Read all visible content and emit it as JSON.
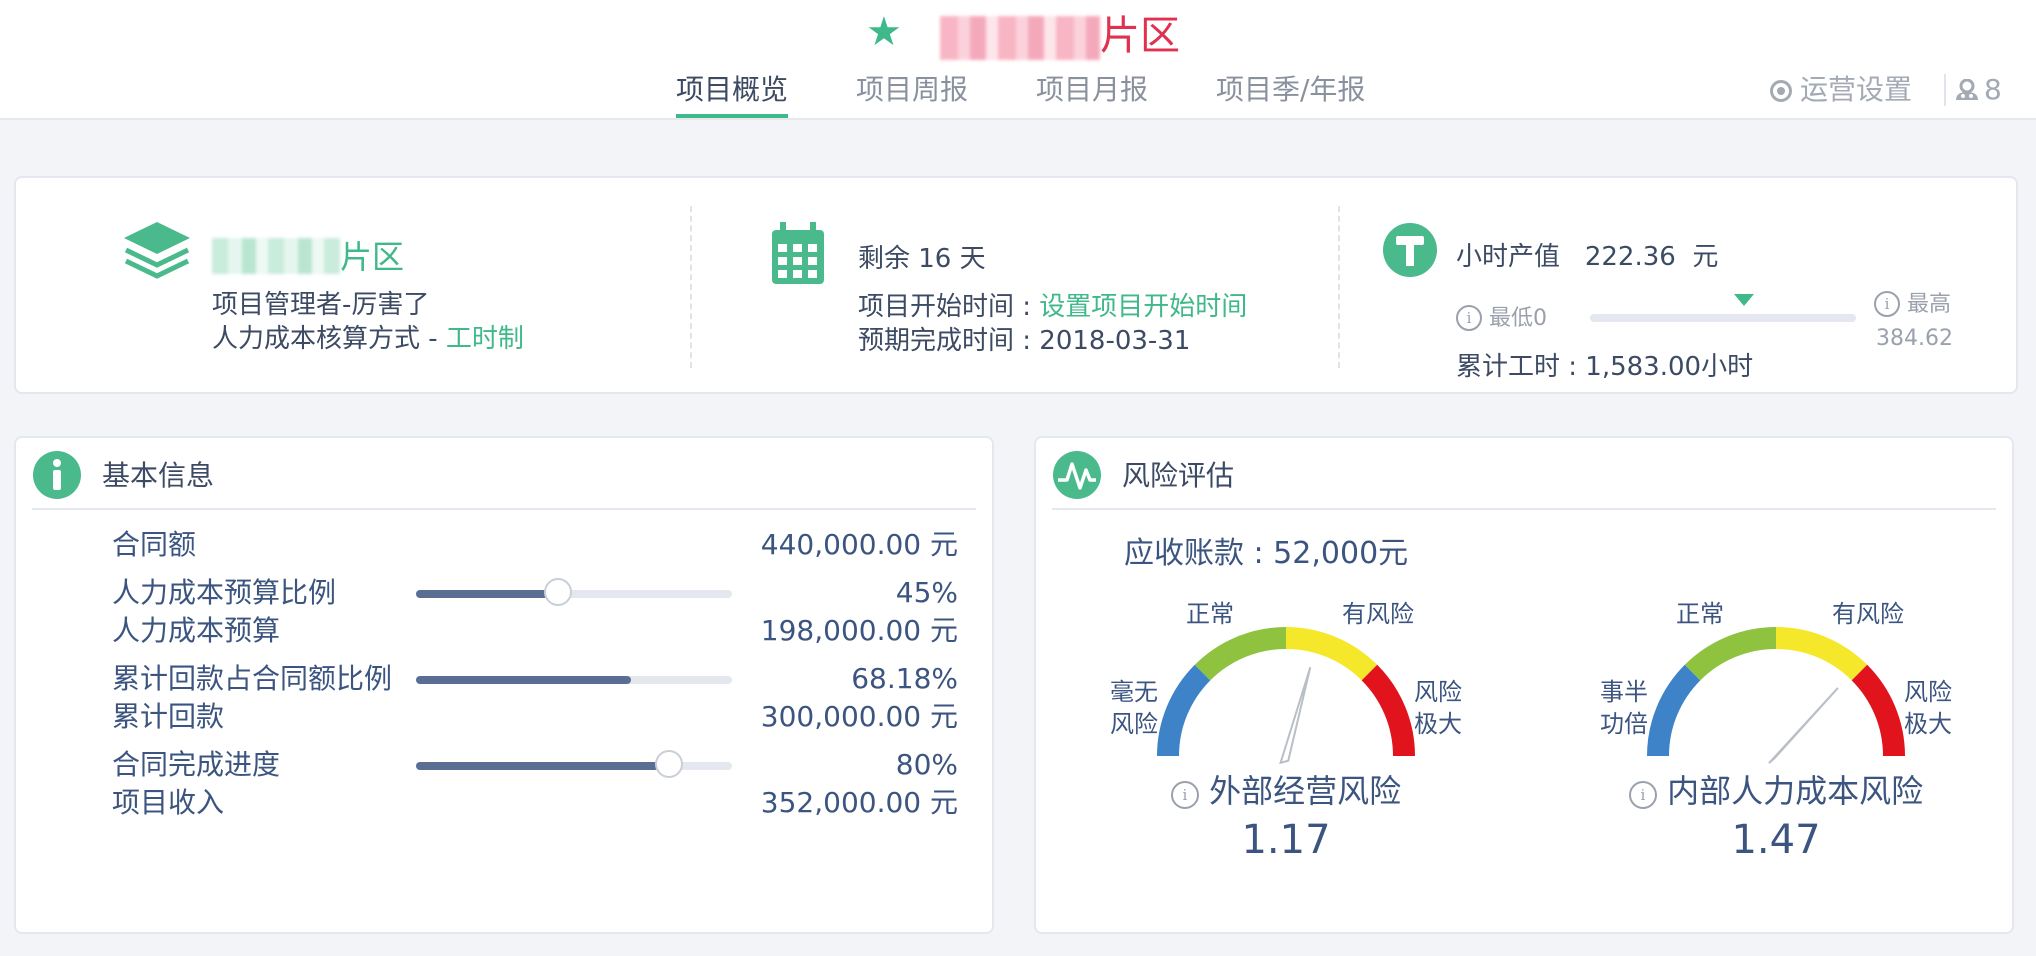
{
  "header": {
    "title_suffix": "片区",
    "tabs": [
      {
        "label": "项目概览"
      },
      {
        "label": "项目周报"
      },
      {
        "label": "项目月报"
      },
      {
        "label": "项目季/年报"
      }
    ],
    "ops_settings": "运营设置",
    "user_count": "8"
  },
  "summary": {
    "area": {
      "name_suffix": "片区",
      "manager": "项目管理者-厉害了",
      "cost_method_label": "人力成本核算方式 - ",
      "cost_method_value": "工时制"
    },
    "schedule": {
      "remaining": "剩余 16 天",
      "start_label": "项目开始时间 : ",
      "start_link": "设置项目开始时间",
      "end_text": "预期完成时间 : 2018-03-31"
    },
    "hourly": {
      "title": "小时产值",
      "value": "222.36",
      "unit": "元",
      "min_label": "最低0",
      "max_label": "最高",
      "max_value": "384.62",
      "marker_fraction": 0.578,
      "total_hours": "累计工时 : 1,583.00小时"
    }
  },
  "basic_info": {
    "title": "基本信息",
    "rows": [
      {
        "label": "合同额",
        "value": "440,000.00 元"
      },
      {
        "label": "人力成本预算比例",
        "value": "45%",
        "fraction": 0.45
      },
      {
        "label": "人力成本预算",
        "value": "198,000.00 元"
      },
      {
        "label": "累计回款占合同额比例",
        "value": "68.18%",
        "fraction": 0.6818
      },
      {
        "label": "累计回款",
        "value": "300,000.00 元"
      },
      {
        "label": "合同完成进度",
        "value": "80%",
        "fraction": 0.8
      },
      {
        "label": "项目收入",
        "value": "352,000.00 元"
      }
    ]
  },
  "risk": {
    "title": "风险评估",
    "receivable": "应收账款 : 52,000元",
    "colors": {
      "blue": "#3e83c7",
      "green": "#8fc23f",
      "yellow": "#f5e82a",
      "red": "#e1141e"
    },
    "gauges": [
      {
        "name": "外部经营风险",
        "value": "1.17",
        "level": 1.17,
        "labels": {
          "far_left_1": "毫无",
          "far_left_2": "风险",
          "left": "正常",
          "right": "有风险",
          "far_right_1": "风险",
          "far_right_2": "极大"
        }
      },
      {
        "name": "内部人力成本风险",
        "value": "1.47",
        "level": 1.47,
        "labels": {
          "far_left_1": "事半",
          "far_left_2": "功倍",
          "left": "正常",
          "right": "有风险",
          "far_right_1": "风险",
          "far_right_2": "极大"
        }
      }
    ]
  }
}
